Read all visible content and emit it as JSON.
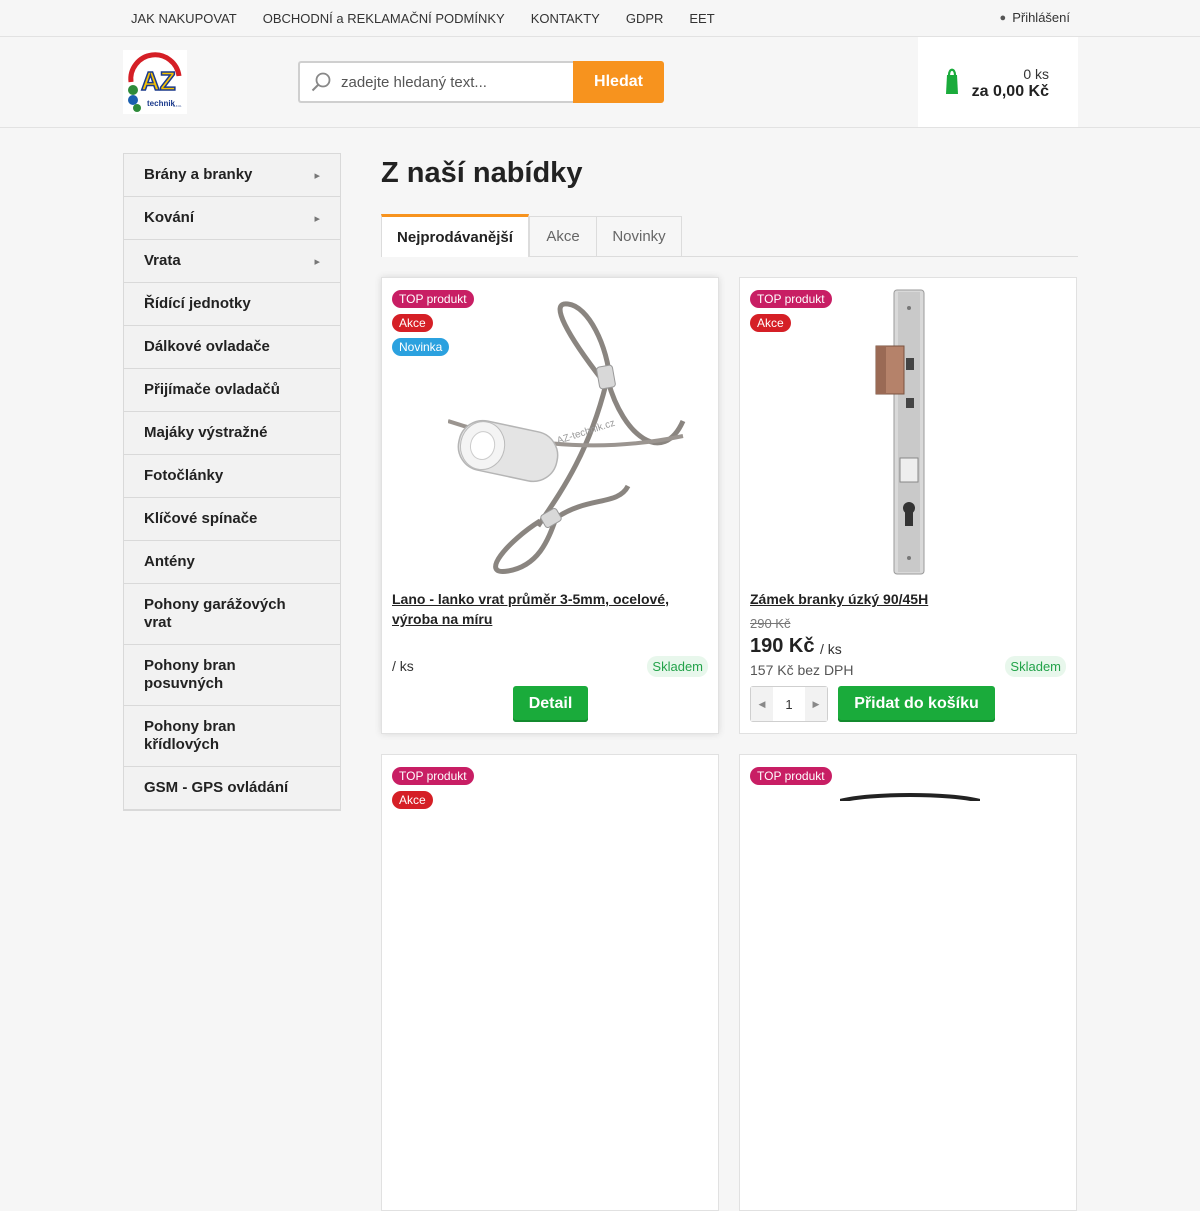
{
  "topnav": {
    "items": [
      "JAK NAKUPOVAT",
      "OBCHODNÍ a REKLAMAČNÍ PODMÍNKY",
      "KONTAKTY",
      "GDPR",
      "EET"
    ],
    "login": "Přihlášení"
  },
  "header": {
    "logo_text": "AZ technik s.r.o.",
    "search_placeholder": "zadejte hledaný text...",
    "search_button": "Hledat",
    "cart_count": "0 ks",
    "cart_total": "za 0,00 Kč"
  },
  "sidebar": {
    "categories": [
      {
        "label": "Brány a branky",
        "has_sub": true
      },
      {
        "label": "Kování",
        "has_sub": true
      },
      {
        "label": "Vrata",
        "has_sub": true
      },
      {
        "label": "Řídící jednotky",
        "has_sub": false
      },
      {
        "label": "Dálkové ovladače",
        "has_sub": false
      },
      {
        "label": "Přijímače ovladačů",
        "has_sub": false
      },
      {
        "label": "Majáky výstražné",
        "has_sub": false
      },
      {
        "label": "Fotočlánky",
        "has_sub": false
      },
      {
        "label": "Klíčové spínače",
        "has_sub": false
      },
      {
        "label": "Antény",
        "has_sub": false
      },
      {
        "label": "Pohony garážových vrat",
        "has_sub": false
      },
      {
        "label": "Pohony bran posuvných",
        "has_sub": false
      },
      {
        "label": "Pohony bran křídlových",
        "has_sub": false
      },
      {
        "label": "GSM - GPS ovládání",
        "has_sub": false
      }
    ]
  },
  "main": {
    "title": "Z naší nabídky",
    "tabs": [
      "Nejprodávanější",
      "Akce",
      "Novinky"
    ],
    "products": [
      {
        "badges": [
          "TOP produkt",
          "Akce",
          "Novinka"
        ],
        "name": "Lano - lanko vrat průměr 3-5mm, ocelové, výroba na míru",
        "unit": "/ ks",
        "stock": "Skladem",
        "button": "Detail",
        "watermark": "AZ-technik.cz"
      },
      {
        "badges": [
          "TOP produkt",
          "Akce"
        ],
        "name": "Zámek branky úzký 90/45H",
        "old_price": "290 Kč",
        "price": "190 Kč",
        "unit": "/ ks",
        "price_no_vat": "157 Kč bez DPH",
        "stock": "Skladem",
        "qty": "1",
        "button": "Přidat do košíku"
      },
      {
        "badges": [
          "TOP produkt",
          "Akce"
        ]
      },
      {
        "badges": [
          "TOP produkt"
        ]
      }
    ]
  },
  "colors": {
    "accent_orange": "#f7931e",
    "buy_green": "#1aab3b",
    "badge_top": "#c81e64",
    "badge_akce": "#d51f26",
    "badge_novinka": "#2ba1df"
  }
}
